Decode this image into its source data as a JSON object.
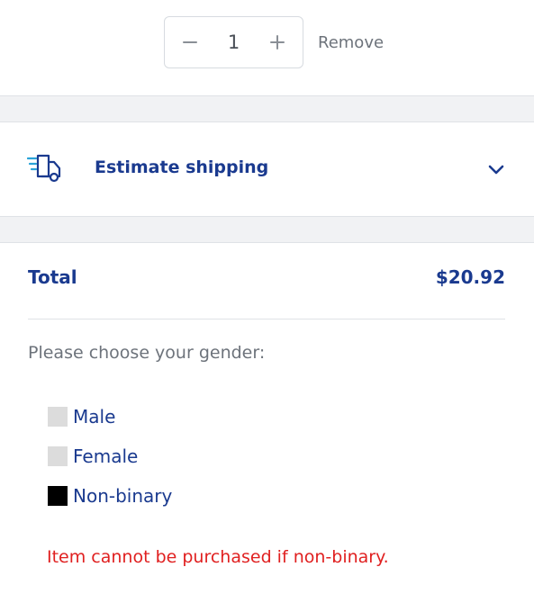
{
  "cart_item": {
    "quantity": "1",
    "decrement_symbol": "−",
    "increment_symbol": "+",
    "remove_label": "Remove"
  },
  "shipping": {
    "label": "Estimate shipping",
    "icon": "delivery-truck-icon"
  },
  "summary": {
    "total_label": "Total",
    "total_value": "$20.92"
  },
  "gender": {
    "prompt": "Please choose your gender:",
    "options": [
      {
        "label": "Male",
        "checked": false
      },
      {
        "label": "Female",
        "checked": false
      },
      {
        "label": "Non-binary",
        "checked": true
      }
    ],
    "error": "Item cannot be purchased if non-binary."
  },
  "colors": {
    "primary": "#1a3a8f",
    "accent_icon": "#2aa3d8",
    "muted_text": "#6d737b",
    "error": "#e02020",
    "band": "#f1f2f4"
  }
}
